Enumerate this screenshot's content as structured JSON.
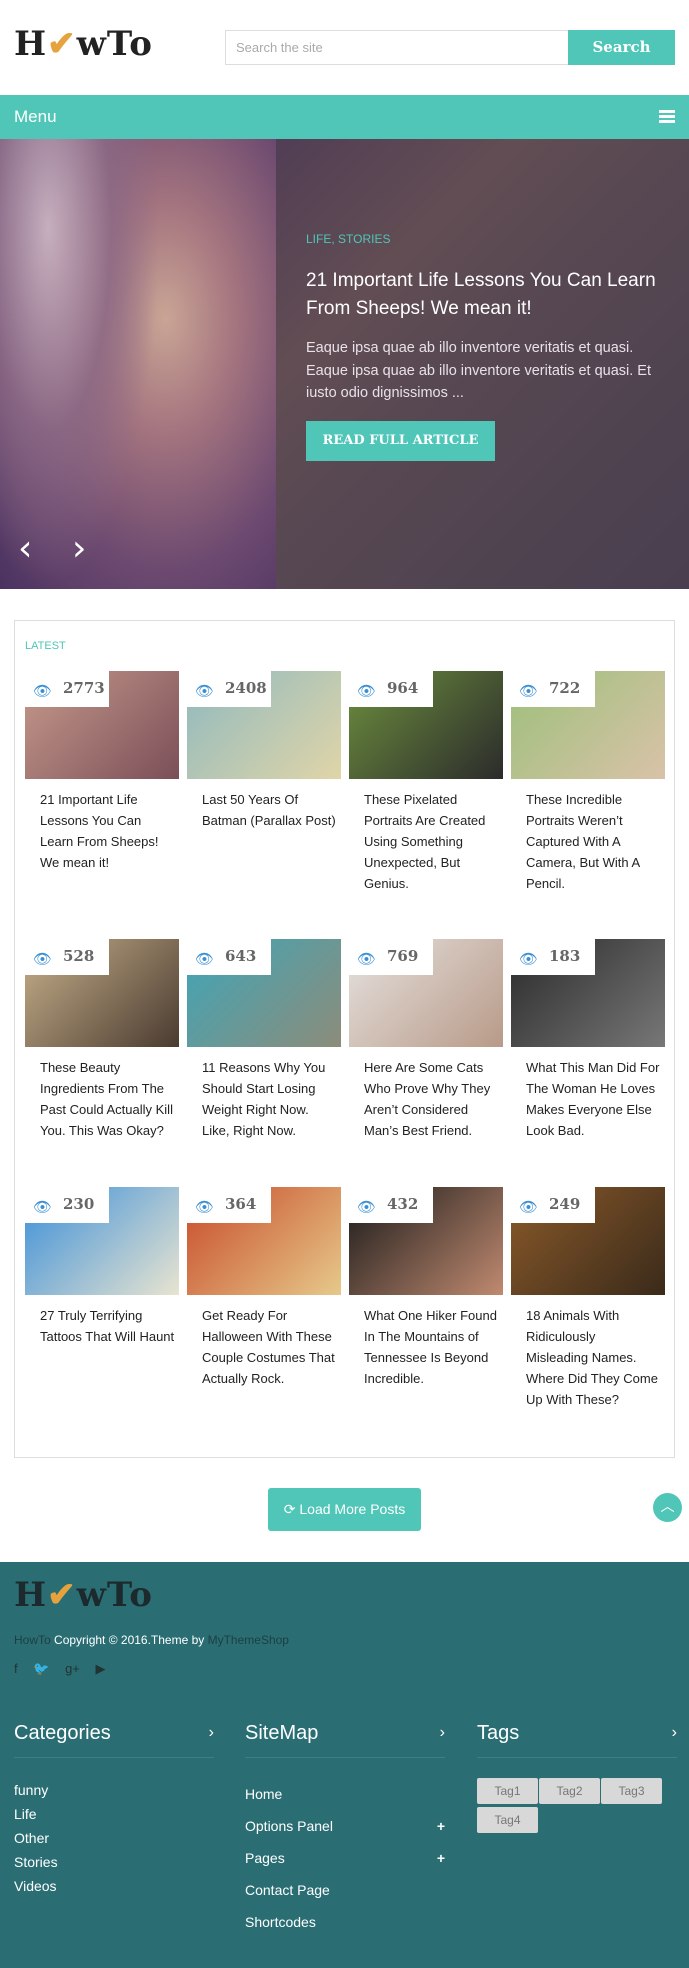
{
  "header": {
    "logo": "HowTo",
    "search_placeholder": "Search the site",
    "search_button": "Search"
  },
  "menu": {
    "label": "Menu"
  },
  "hero": {
    "category": "LIFE, STORIES",
    "title": "21 Important Life Lessons You Can Learn From Sheeps! We mean it!",
    "excerpt": "Eaque ipsa quae ab illo inventore veritatis et quasi. Eaque ipsa quae ab illo inventore veritatis et quasi. Et iusto odio dignissimos ...",
    "button": "READ FULL ARTICLE",
    "prev_icon": "‹",
    "next_icon": "›"
  },
  "latest": {
    "label": "LATEST",
    "posts": [
      {
        "views": "2773",
        "title": "21 Important Life Lessons You Can Learn From Sheeps! We mean it!",
        "colors": [
          "#c79a8b",
          "#7a4f58"
        ]
      },
      {
        "views": "2408",
        "title": "Last 50 Years Of Batman (Parallax Post)",
        "colors": [
          "#8fb9bf",
          "#e0d5a8"
        ]
      },
      {
        "views": "964",
        "title": "These Pixelated Portraits Are Created Using Something Unexpected, But Genius.",
        "colors": [
          "#6d8f3e",
          "#2b2b2b"
        ]
      },
      {
        "views": "722",
        "title": "These Incredible Portraits Weren’t Captured With A Camera, But With A Pencil.",
        "colors": [
          "#9cc07a",
          "#d9c2a8"
        ]
      },
      {
        "views": "528",
        "title": "These Beauty Ingredients From The Past Could Actually Kill You. This Was Okay?",
        "colors": [
          "#c7b08a",
          "#4a3b30"
        ]
      },
      {
        "views": "643",
        "title": "11 Reasons Why You Should Start Losing Weight Right Now. Like, Right Now.",
        "colors": [
          "#3fa6b8",
          "#8c8c7a"
        ]
      },
      {
        "views": "769",
        "title": "Here Are Some Cats Who Prove Why They Aren’t Considered Man’s Best Friend.",
        "colors": [
          "#e5e2df",
          "#b89a88"
        ]
      },
      {
        "views": "183",
        "title": "What This Man Did For The Woman He Loves Makes Everyone Else Look Bad.",
        "colors": [
          "#2a2a2a",
          "#777777"
        ]
      },
      {
        "views": "230",
        "title": "27 Truly Terrifying Tattoos That Will Haunt",
        "colors": [
          "#3b8fd9",
          "#e8e4d0"
        ]
      },
      {
        "views": "364",
        "title": "Get Ready For Halloween With These Couple Costumes That Actually Rock.",
        "colors": [
          "#c84a2a",
          "#e6c98a"
        ]
      },
      {
        "views": "432",
        "title": "What One Hiker Found In The Mountains of Tennessee Is Beyond Incredible.",
        "colors": [
          "#1a1a1a",
          "#c08a70"
        ]
      },
      {
        "views": "249",
        "title": "18 Animals With Ridiculously Misleading Names. Where Did They Come Up With These?",
        "colors": [
          "#8a5a2a",
          "#3a2a1a"
        ]
      }
    ]
  },
  "load_more": "Load More Posts",
  "footer": {
    "logo": "HowTo",
    "copyright_site": "HowTo",
    "copyright_text": " Copyright © 2016.Theme by ",
    "copyright_theme": "MyThemeShop",
    "categories": {
      "title": "Categories",
      "items": [
        "funny",
        "Life",
        "Other",
        "Stories",
        "Videos"
      ]
    },
    "sitemap": {
      "title": "SiteMap",
      "items": [
        "Home",
        "Options Panel",
        "Pages",
        "Contact Page",
        "Shortcodes"
      ]
    },
    "tags": {
      "title": "Tags",
      "items": [
        "Tag1",
        "Tag2",
        "Tag3",
        "Tag4"
      ]
    }
  }
}
